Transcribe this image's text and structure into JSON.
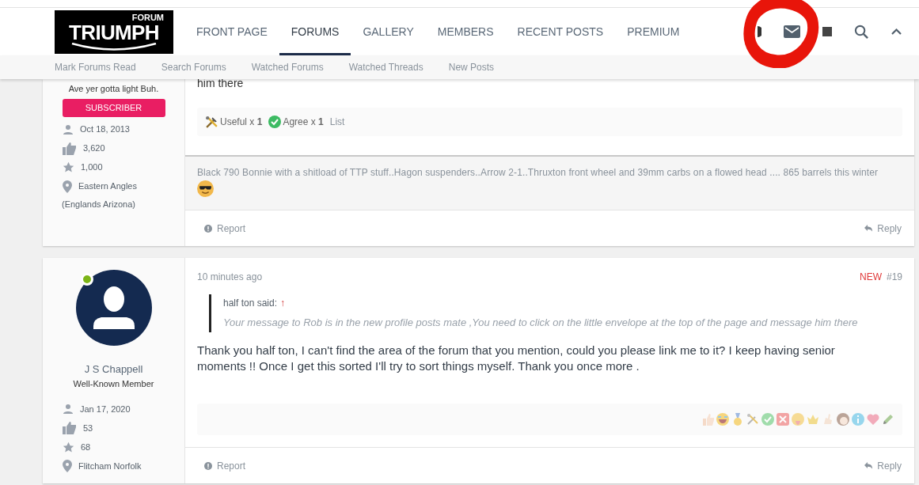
{
  "logo": {
    "small": "FORUM",
    "large": "TRIUMPH"
  },
  "nav": [
    {
      "label": "FRONT PAGE",
      "selected": false
    },
    {
      "label": "FORUMS",
      "selected": true
    },
    {
      "label": "GALLERY",
      "selected": false
    },
    {
      "label": "MEMBERS",
      "selected": false
    },
    {
      "label": "RECENT POSTS",
      "selected": false
    },
    {
      "label": "PREMIUM",
      "selected": false
    }
  ],
  "subnav": [
    "Mark Forums Read",
    "Search Forums",
    "Watched Forums",
    "Watched Threads",
    "New Posts"
  ],
  "posts": [
    {
      "user": {
        "title": "Ave yer gotta light Buh.",
        "badge": "SUBSCRIBER",
        "stats": [
          {
            "kind": "joined",
            "text": "Oct 18, 2013"
          },
          {
            "kind": "likes",
            "text": "3,620"
          },
          {
            "kind": "points",
            "text": "1,000"
          },
          {
            "kind": "location",
            "text": "Eastern Angles"
          }
        ],
        "extra": "(Englands Arizona)"
      },
      "body": "him there",
      "reactions": [
        {
          "kind": "useful",
          "text": "Useful x **1**"
        },
        {
          "kind": "agree",
          "text": "Agree x **1**"
        }
      ],
      "list_link": "List",
      "signature": "Black 790 Bonnie with a shitload of TTP stuff..Hagon suspenders..Arrow 2-1..Thruxton front wheel and 39mm carbs on a flowed head .... 865 barrels this winter",
      "report": "Report",
      "reply": "Reply"
    },
    {
      "user": {
        "online": true,
        "name": "J S Chappell",
        "title": "Well-Known Member",
        "stats": [
          {
            "kind": "joined",
            "text": "Jan 17, 2020"
          },
          {
            "kind": "likes",
            "text": "53"
          },
          {
            "kind": "points",
            "text": "68"
          },
          {
            "kind": "location",
            "text": "Flitcham Norfolk"
          }
        ]
      },
      "time": "10 minutes ago",
      "new_label": "NEW",
      "number": "#19",
      "quote": {
        "author": "half ton said:",
        "arrow": "↑",
        "text": "Your message to Rob is in the new profile posts mate ,You need to click on the little envelope at the top of the page and message him there"
      },
      "body": "Thank you half ton, I can't find the area of the forum that you mention, could you please link me to it? I keep having senior moments !! Once I get this sorted I'll try to sort things myself. Thank you once more .",
      "report": "Report",
      "reply": "Reply"
    }
  ]
}
